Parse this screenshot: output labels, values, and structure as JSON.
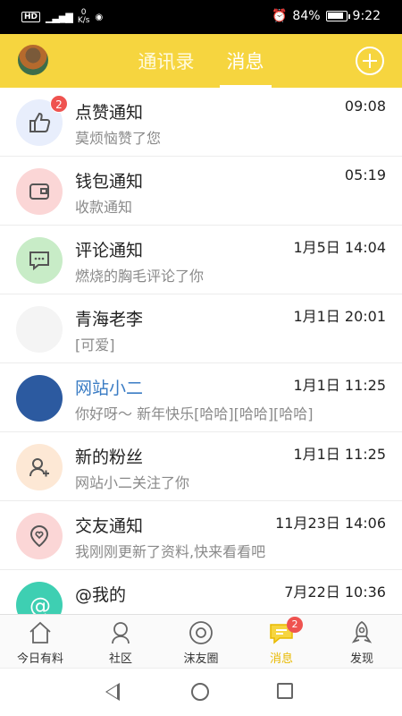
{
  "status": {
    "net_speed_value": "0",
    "net_speed_unit": "K/s",
    "battery": "84%",
    "battery_level": 0.84,
    "time": "9:22"
  },
  "header": {
    "tabs": [
      "通讯录",
      "消息"
    ],
    "active_tab": "消息"
  },
  "messages": [
    {
      "title": "点赞通知",
      "subtitle": "莫烦恼赞了您",
      "time": "09:08",
      "badge": "2",
      "icon": "thumbs-up-icon",
      "color": "#e8eefc"
    },
    {
      "title": "钱包通知",
      "subtitle": "收款通知",
      "time": "05:19",
      "icon": "wallet-icon",
      "color": "#fbd6d6"
    },
    {
      "title": "评论通知",
      "subtitle": "燃烧的胸毛评论了你",
      "time": "1月5日 14:04",
      "icon": "comment-icon",
      "color": "#c8ecc7"
    },
    {
      "title": "青海老李",
      "subtitle": "[可爱]",
      "time": "1月1日 20:01",
      "icon": "user-avatar",
      "color": "#f4f4f4"
    },
    {
      "title": "网站小二",
      "subtitle": "你好呀～ 新年快乐[哈哈][哈哈][哈哈]",
      "time": "1月1日 11:25",
      "icon": "user-avatar",
      "color": "#2c5aa0"
    },
    {
      "title": "新的粉丝",
      "subtitle": "网站小二关注了你",
      "time": "1月1日 11:25",
      "icon": "new-follower-icon",
      "color": "#fde8d5"
    },
    {
      "title": "交友通知",
      "subtitle": "我刚刚更新了资料,快来看看吧",
      "time": "11月23日 14:06",
      "icon": "heart-location-icon",
      "color": "#fbd6d6"
    },
    {
      "title": "@我的",
      "subtitle": "",
      "time": "7月22日 10:36",
      "icon": "at-icon",
      "color": "#3ecfb2"
    }
  ],
  "tabbar": [
    {
      "label": "今日有料",
      "icon": "home-icon"
    },
    {
      "label": "社区",
      "icon": "community-icon"
    },
    {
      "label": "沫友圈",
      "icon": "moments-icon"
    },
    {
      "label": "消息",
      "icon": "message-icon",
      "badge": "2",
      "active": true
    },
    {
      "label": "发现",
      "icon": "rocket-icon"
    }
  ],
  "colors": {
    "accent": "#f6d53f",
    "badge": "#ef5350",
    "tab_active": "#e8b900"
  }
}
